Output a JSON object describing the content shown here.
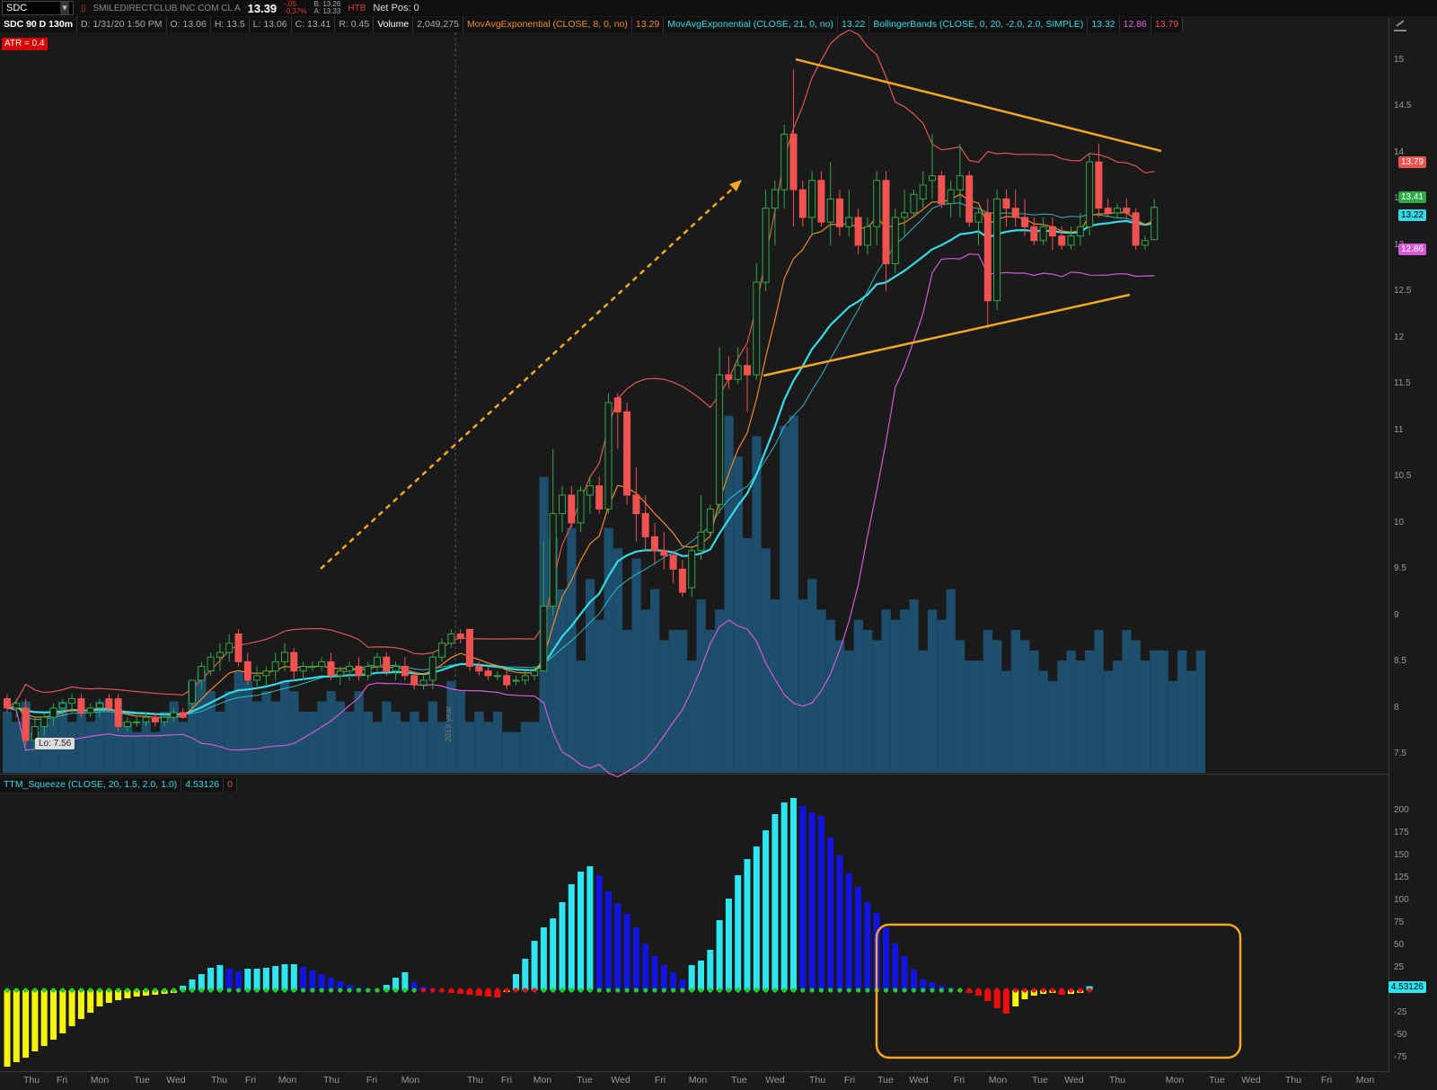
{
  "header": {
    "symbol": "SDC",
    "company_name": "SMILEDIRECTCLUB INC COM CL A",
    "last_price": "13.39",
    "change": "-.05",
    "change_pct": "-0.37%",
    "bid": "B: 13.26",
    "ask": "A: 13.33",
    "htb": "HTB",
    "net_pos": "Net Pos: 0"
  },
  "infobar": {
    "chart_label": "SDC 90 D 130m",
    "date": "D: 1/31/20 1:50 PM",
    "open": "O: 13.06",
    "high": "H: 13.5",
    "low": "L: 13.06",
    "close": "C: 13.41",
    "range": "R: 0.45",
    "volume_label": "Volume",
    "volume_value": "2,049,275",
    "ema8_label": "MovAvgExponential (CLOSE, 8, 0, no)",
    "ema8_value": "13.29",
    "ema21_label": "MovAvgExponential (CLOSE, 21, 0, no)",
    "ema21_value": "13.22",
    "bb_label": "BollingerBands (CLOSE, 0, 20, -2.0, 2.0, SIMPLE)",
    "bb_mid": "13.32",
    "bb_low": "12.86",
    "bb_up": "13.79"
  },
  "atr_label": "ATR = 0.4",
  "lo_label": "Lo: 7.56",
  "year_marker": "2019 year",
  "squeeze": {
    "label": "TTM_Squeeze (CLOSE, 20, 1.5, 2.0, 1.0)",
    "value": "4.53126",
    "zero": "0"
  },
  "price_axis_ticks": [
    "15",
    "14.5",
    "14",
    "13.5",
    "13",
    "12.5",
    "12",
    "11.5",
    "11",
    "10.5",
    "10",
    "9.5",
    "9",
    "8.5",
    "8",
    "7.5"
  ],
  "price_tags": {
    "bb_up": "13.79",
    "last": "13.41",
    "ema21": "13.22",
    "bb_low": "12.86"
  },
  "squeeze_axis_ticks": [
    "200",
    "175",
    "150",
    "125",
    "100",
    "75",
    "50",
    "25",
    "0",
    "-25",
    "-50",
    "-75"
  ],
  "squeeze_tag": "4.53126",
  "x_axis_ticks": [
    "Thu",
    "Fri",
    "Mon",
    "Tue",
    "Wed",
    "Thu",
    "Fri",
    "Mon",
    "Thu",
    "Fri",
    "Mon",
    "Thu",
    "Fri",
    "Mon",
    "Tue",
    "Wed",
    "Fri",
    "Mon",
    "Tue",
    "Wed",
    "Thu",
    "Fri",
    "Tue",
    "Wed",
    "Fri",
    "Mon",
    "Tue",
    "Wed",
    "Thu",
    "Mon",
    "Tue",
    "Wed",
    "Thu",
    "Fri",
    "Mon"
  ],
  "colors": {
    "bull": "#2eaa45",
    "bear": "#ef5350",
    "volume": "#1d4e6b",
    "ema8": "#f08a24",
    "ema21": "#37d9e6",
    "bb_band": "#e05555",
    "bb_low": "#d659d8",
    "sq_cyan": "#2ee6f2",
    "sq_blue": "#1414e0",
    "sq_yellow": "#f4f40c",
    "sq_red": "#ee0c0c",
    "annotation": "#f5a623"
  },
  "chart_data": [
    {
      "type": "candlestick",
      "title": "SDC 90 D 130m",
      "ylim": [
        7.3,
        15.3
      ],
      "grid": false,
      "candles_ohlc": [
        [
          8.1,
          8.15,
          7.95,
          8.0
        ],
        [
          8.0,
          8.1,
          7.9,
          8.05
        ],
        [
          8.0,
          8.1,
          7.6,
          7.65
        ],
        [
          7.65,
          7.9,
          7.56,
          7.8
        ],
        [
          7.8,
          7.95,
          7.7,
          7.9
        ],
        [
          7.9,
          8.05,
          7.8,
          8.0
        ],
        [
          8.0,
          8.1,
          7.9,
          8.05
        ],
        [
          8.05,
          8.15,
          7.95,
          8.1
        ],
        [
          8.1,
          8.15,
          7.9,
          7.95
        ],
        [
          7.95,
          8.05,
          7.9,
          8.0
        ],
        [
          8.0,
          8.1,
          7.9,
          8.05
        ],
        [
          8.1,
          8.15,
          7.95,
          8.0
        ],
        [
          8.1,
          8.15,
          7.75,
          7.8
        ],
        [
          7.8,
          7.9,
          7.75,
          7.85
        ],
        [
          7.85,
          7.9,
          7.8,
          7.85
        ],
        [
          7.85,
          7.95,
          7.8,
          7.9
        ],
        [
          7.9,
          7.95,
          7.8,
          7.85
        ],
        [
          7.85,
          7.95,
          7.8,
          7.9
        ],
        [
          7.9,
          8.0,
          7.85,
          7.95
        ],
        [
          7.95,
          8.0,
          7.88,
          7.9
        ],
        [
          8.05,
          8.3,
          8.0,
          8.3
        ],
        [
          8.3,
          8.5,
          8.2,
          8.45
        ],
        [
          8.4,
          8.6,
          8.35,
          8.55
        ],
        [
          8.55,
          8.7,
          8.4,
          8.6
        ],
        [
          8.6,
          8.8,
          8.5,
          8.7
        ],
        [
          8.8,
          8.85,
          8.45,
          8.5
        ],
        [
          8.5,
          8.6,
          8.25,
          8.3
        ],
        [
          8.3,
          8.45,
          8.2,
          8.35
        ],
        [
          8.35,
          8.45,
          8.25,
          8.4
        ],
        [
          8.4,
          8.6,
          8.3,
          8.5
        ],
        [
          8.5,
          8.7,
          8.4,
          8.6
        ],
        [
          8.6,
          8.65,
          8.3,
          8.4
        ],
        [
          8.4,
          8.5,
          8.3,
          8.45
        ],
        [
          8.45,
          8.5,
          8.4,
          8.45
        ],
        [
          8.45,
          8.55,
          8.4,
          8.5
        ],
        [
          8.5,
          8.6,
          8.3,
          8.35
        ],
        [
          8.35,
          8.45,
          8.25,
          8.4
        ],
        [
          8.4,
          8.5,
          8.3,
          8.45
        ],
        [
          8.45,
          8.55,
          8.3,
          8.35
        ],
        [
          8.35,
          8.5,
          8.3,
          8.45
        ],
        [
          8.45,
          8.6,
          8.4,
          8.55
        ],
        [
          8.55,
          8.6,
          8.35,
          8.4
        ],
        [
          8.4,
          8.5,
          8.3,
          8.45
        ],
        [
          8.45,
          8.55,
          8.3,
          8.35
        ],
        [
          8.35,
          8.4,
          8.2,
          8.25
        ],
        [
          8.25,
          8.35,
          8.2,
          8.3
        ],
        [
          8.3,
          8.6,
          8.2,
          8.55
        ],
        [
          8.55,
          8.75,
          8.5,
          8.7
        ],
        [
          8.7,
          8.85,
          8.65,
          8.8
        ],
        [
          8.8,
          8.85,
          8.7,
          8.75
        ],
        [
          8.85,
          8.85,
          8.4,
          8.45
        ],
        [
          8.45,
          8.5,
          8.35,
          8.4
        ],
        [
          8.4,
          8.45,
          8.3,
          8.35
        ],
        [
          8.35,
          8.4,
          8.3,
          8.35
        ],
        [
          8.35,
          8.4,
          8.2,
          8.25
        ],
        [
          8.3,
          8.35,
          8.25,
          8.3
        ],
        [
          8.3,
          8.4,
          8.25,
          8.35
        ],
        [
          8.35,
          8.45,
          8.3,
          8.4
        ],
        [
          8.4,
          9.8,
          8.4,
          9.1
        ],
        [
          9.1,
          10.8,
          9.0,
          10.1
        ],
        [
          10.1,
          10.4,
          9.9,
          10.3
        ],
        [
          10.3,
          10.4,
          9.95,
          10.0
        ],
        [
          10.0,
          10.4,
          9.9,
          10.35
        ],
        [
          10.3,
          10.5,
          10.1,
          10.4
        ],
        [
          10.4,
          10.5,
          10.1,
          10.15
        ],
        [
          10.15,
          11.4,
          10.1,
          11.3
        ],
        [
          11.35,
          11.4,
          10.8,
          11.2
        ],
        [
          11.2,
          11.3,
          10.2,
          10.3
        ],
        [
          10.3,
          10.6,
          9.8,
          10.1
        ],
        [
          10.1,
          10.3,
          9.7,
          9.85
        ],
        [
          9.85,
          10.0,
          9.55,
          9.7
        ],
        [
          9.7,
          9.9,
          9.5,
          9.65
        ],
        [
          9.65,
          9.7,
          9.35,
          9.5
        ],
        [
          9.5,
          9.6,
          9.2,
          9.25
        ],
        [
          9.3,
          9.75,
          9.2,
          9.7
        ],
        [
          9.7,
          10.3,
          9.6,
          9.9
        ],
        [
          9.9,
          10.2,
          9.85,
          10.15
        ],
        [
          10.2,
          11.9,
          10.1,
          11.6
        ],
        [
          11.6,
          11.8,
          11.45,
          11.55
        ],
        [
          11.55,
          11.9,
          11.5,
          11.7
        ],
        [
          11.7,
          11.9,
          11.2,
          11.6
        ],
        [
          11.6,
          12.8,
          11.55,
          12.6
        ],
        [
          12.6,
          13.6,
          12.5,
          13.4
        ],
        [
          13.4,
          13.7,
          13.0,
          13.6
        ],
        [
          13.6,
          14.3,
          13.4,
          14.2
        ],
        [
          14.2,
          14.9,
          13.2,
          13.6
        ],
        [
          13.6,
          13.7,
          13.2,
          13.3
        ],
        [
          13.3,
          13.8,
          13.1,
          13.7
        ],
        [
          13.7,
          13.8,
          13.2,
          13.25
        ],
        [
          13.25,
          13.9,
          13.0,
          13.5
        ],
        [
          13.5,
          13.6,
          13.1,
          13.2
        ],
        [
          13.2,
          13.6,
          13.1,
          13.3
        ],
        [
          13.3,
          13.4,
          12.9,
          13.0
        ],
        [
          13.0,
          13.3,
          12.9,
          13.2
        ],
        [
          13.2,
          13.8,
          13.0,
          13.7
        ],
        [
          13.7,
          13.8,
          12.5,
          12.8
        ],
        [
          12.8,
          13.4,
          12.7,
          13.3
        ],
        [
          13.3,
          13.6,
          13.1,
          13.35
        ],
        [
          13.35,
          13.6,
          13.3,
          13.55
        ],
        [
          13.5,
          13.8,
          13.4,
          13.65
        ],
        [
          13.7,
          14.2,
          13.5,
          13.75
        ],
        [
          13.75,
          13.8,
          13.4,
          13.45
        ],
        [
          13.45,
          13.7,
          13.3,
          13.6
        ],
        [
          13.6,
          14.1,
          13.3,
          13.75
        ],
        [
          13.75,
          13.8,
          13.2,
          13.25
        ],
        [
          13.25,
          13.4,
          13.0,
          13.35
        ],
        [
          13.35,
          13.5,
          12.1,
          12.4
        ],
        [
          12.4,
          13.6,
          12.3,
          13.5
        ],
        [
          13.5,
          13.6,
          13.2,
          13.4
        ],
        [
          13.4,
          13.6,
          13.2,
          13.3
        ],
        [
          13.3,
          13.5,
          13.1,
          13.2
        ],
        [
          13.2,
          13.3,
          13.0,
          13.05
        ],
        [
          13.05,
          13.3,
          13.0,
          13.2
        ],
        [
          13.2,
          13.3,
          12.95,
          13.1
        ],
        [
          13.1,
          13.2,
          12.95,
          13.0
        ],
        [
          13.0,
          13.2,
          12.95,
          13.1
        ],
        [
          13.1,
          13.35,
          13.0,
          13.2
        ],
        [
          13.2,
          14.0,
          13.1,
          13.9
        ],
        [
          13.9,
          14.1,
          13.3,
          13.4
        ],
        [
          13.4,
          13.5,
          13.3,
          13.35
        ],
        [
          13.35,
          13.45,
          13.3,
          13.4
        ],
        [
          13.4,
          13.5,
          13.3,
          13.35
        ],
        [
          13.35,
          13.4,
          12.95,
          13.0
        ],
        [
          13.0,
          13.1,
          12.95,
          13.05
        ],
        [
          13.06,
          13.5,
          13.06,
          13.41
        ]
      ],
      "volume_millions": [
        0.6,
        0.5,
        0.7,
        0.4,
        0.5,
        0.6,
        0.7,
        0.5,
        0.6,
        0.5,
        0.7,
        0.6,
        0.6,
        0.5,
        0.4,
        0.5,
        0.4,
        0.6,
        0.7,
        0.5,
        0.9,
        1.0,
        0.8,
        0.6,
        0.8,
        1.0,
        0.9,
        0.7,
        0.8,
        0.7,
        0.9,
        0.8,
        0.6,
        0.6,
        0.7,
        0.8,
        0.7,
        0.6,
        0.8,
        0.6,
        0.5,
        0.7,
        0.6,
        0.5,
        0.6,
        0.5,
        0.7,
        0.5,
        0.9,
        0.8,
        0.5,
        0.6,
        0.5,
        0.6,
        0.4,
        0.4,
        0.5,
        0.5,
        2.9,
        2.3,
        1.8,
        2.4,
        1.1,
        1.9,
        1.5,
        2.4,
        2.2,
        1.4,
        2.1,
        1.6,
        1.8,
        1.3,
        1.4,
        1.4,
        1.1,
        1.7,
        1.4,
        1.6,
        3.5,
        3.1,
        2.3,
        3.3,
        2.2,
        1.7,
        3.4,
        3.5,
        1.7,
        1.9,
        1.6,
        1.5,
        1.3,
        1.2,
        1.5,
        1.4,
        1.3,
        1.6,
        1.5,
        1.6,
        1.7,
        1.2,
        1.6,
        1.5,
        1.8,
        1.3,
        1.1,
        1.1,
        1.4,
        1.3,
        1.0,
        1.4,
        1.3,
        1.2,
        1.0,
        0.9,
        1.1,
        1.2,
        1.1,
        1.2,
        1.4,
        1.0,
        1.1,
        1.4,
        1.3,
        1.1,
        1.2,
        1.2,
        0.9,
        1.2,
        1.0,
        1.2
      ],
      "ema8_last": 13.29,
      "ema21_last": 13.22,
      "bollinger_last": {
        "upper": 13.79,
        "middle": 13.32,
        "lower": 12.86
      },
      "annotations": [
        "dashed arrow rising from the December base toward the January high",
        "converging trendlines (descending from 14.9, rising from 11.55) forming a symmetric triangle"
      ]
    },
    {
      "type": "bar",
      "title": "TTM_Squeeze (CLOSE, 20, 1.5, 2.0, 1.0)",
      "ylim": [
        -90,
        215
      ],
      "values": [
        -85,
        -80,
        -75,
        -68,
        -62,
        -55,
        -48,
        -40,
        -32,
        -25,
        -18,
        -14,
        -11,
        -9,
        -7,
        -6,
        -5,
        -4,
        -3,
        5,
        12,
        18,
        25,
        28,
        24,
        21,
        24,
        24,
        25,
        27,
        29,
        29,
        26,
        22,
        18,
        14,
        10,
        6,
        3,
        2,
        0,
        6,
        14,
        20,
        9,
        4,
        2,
        -1,
        -3,
        -4,
        -5,
        -6,
        -7,
        -8,
        -2,
        18,
        35,
        55,
        70,
        80,
        98,
        118,
        132,
        138,
        128,
        110,
        97,
        85,
        70,
        52,
        38,
        28,
        20,
        12,
        28,
        33,
        45,
        78,
        102,
        128,
        146,
        160,
        178,
        196,
        209,
        214,
        205,
        198,
        194,
        170,
        150,
        130,
        115,
        98,
        86,
        70,
        52,
        38,
        23,
        12,
        9,
        5,
        3,
        -1,
        -3,
        -6,
        -12,
        -20,
        -26,
        -18,
        -10,
        -6,
        -4,
        -3,
        -5,
        -4,
        -3,
        4.53
      ],
      "color_state": "cyan=rising above 0, blue=falling above 0, red=falling below 0, yellow=rising below 0",
      "dots": "red = squeeze on, green = squeeze off",
      "annotation": "highlight box around the latest low-momentum section"
    }
  ]
}
